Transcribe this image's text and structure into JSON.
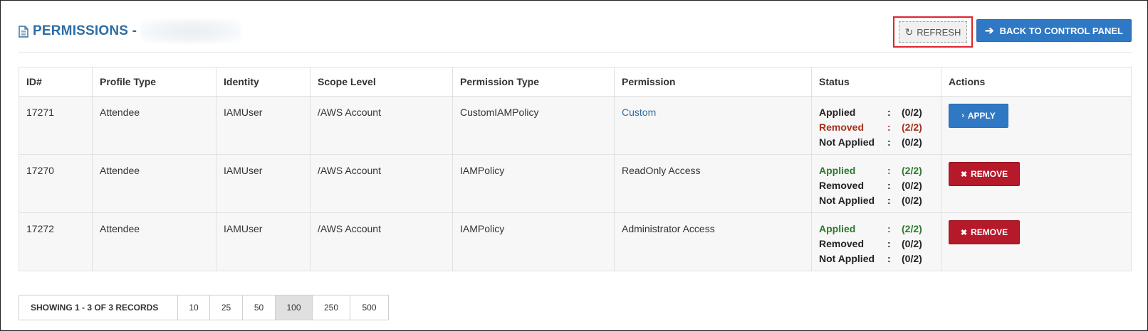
{
  "header": {
    "title": "PERMISSIONS -",
    "refresh_label": "REFRESH",
    "back_label": "BACK TO CONTROL PANEL"
  },
  "table": {
    "columns": [
      "ID#",
      "Profile Type",
      "Identity",
      "Scope Level",
      "Permission Type",
      "Permission",
      "Status",
      "Actions"
    ],
    "rows": [
      {
        "id": "17271",
        "profile_type": "Attendee",
        "identity": "IAMUser",
        "scope": "/AWS Account",
        "perm_type": "CustomIAMPolicy",
        "permission": "Custom",
        "status": [
          {
            "label": "Applied",
            "sep": ":",
            "value": "(0/2)"
          },
          {
            "label": "Removed",
            "sep": ":",
            "value": "(2/2)"
          },
          {
            "label": "Not Applied",
            "sep": ":",
            "value": "(0/2)"
          }
        ],
        "action": "APPLY"
      },
      {
        "id": "17270",
        "profile_type": "Attendee",
        "identity": "IAMUser",
        "scope": "/AWS Account",
        "perm_type": "IAMPolicy",
        "permission": "ReadOnly Access",
        "status": [
          {
            "label": "Applied",
            "sep": ":",
            "value": "(2/2)"
          },
          {
            "label": "Removed",
            "sep": ":",
            "value": "(0/2)"
          },
          {
            "label": "Not Applied",
            "sep": ":",
            "value": "(0/2)"
          }
        ],
        "action": "REMOVE"
      },
      {
        "id": "17272",
        "profile_type": "Attendee",
        "identity": "IAMUser",
        "scope": "/AWS Account",
        "perm_type": "IAMPolicy",
        "permission": "Administrator Access",
        "status": [
          {
            "label": "Applied",
            "sep": ":",
            "value": "(2/2)"
          },
          {
            "label": "Removed",
            "sep": ":",
            "value": "(0/2)"
          },
          {
            "label": "Not Applied",
            "sep": ":",
            "value": "(0/2)"
          }
        ],
        "action": "REMOVE"
      }
    ]
  },
  "pagination": {
    "info": "SHOWING 1 - 3 OF 3 RECORDS",
    "sizes": [
      "10",
      "25",
      "50",
      "100",
      "250",
      "500"
    ],
    "selected": "100"
  },
  "colors": {
    "accent": "#2f78c4",
    "danger": "#b5192a",
    "status_green": "#2b7a2b",
    "status_red": "#a5301b",
    "highlight_border": "#e0242a"
  }
}
